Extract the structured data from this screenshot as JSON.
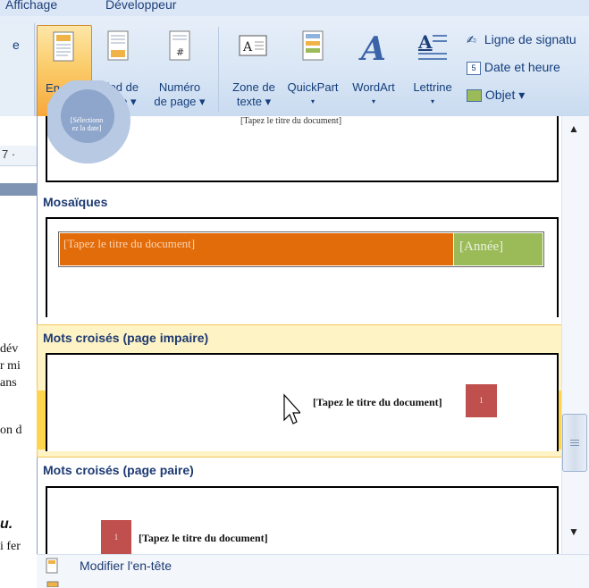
{
  "tabs": [
    "Affichage",
    "Développeur"
  ],
  "ribbon": {
    "header_btn": {
      "line1": "En-tête",
      "arrow": "▾"
    },
    "footer_btn": {
      "line1": "Pied de",
      "line2": "page ▾"
    },
    "pagenum_btn": {
      "line1": "Numéro",
      "line2": "de page ▾"
    },
    "textbox_btn": {
      "line1": "Zone de",
      "line2": "texte ▾"
    },
    "quickpart_btn": {
      "line1": "QuickPart",
      "line2": "▾"
    },
    "wordart_btn": {
      "line1": "WordArt",
      "line2": "▾"
    },
    "dropcap_btn": {
      "line1": "Lettrine",
      "line2": "▾"
    },
    "signature_item": "Ligne de signatu",
    "datetime_item": "Date et heure",
    "object_item": "Objet ▾",
    "left_edge_letter": "e"
  },
  "left_doc": {
    "ruler_text": "7 ·",
    "line1": "dév",
    "line2": "r mi",
    "line3": "ans",
    "line4": "on d",
    "line5": "u.",
    "line6": "i fer"
  },
  "gallery": {
    "top_preview": {
      "circle_text_1": "[Sélectionn",
      "circle_text_2": "ez la date]",
      "title_text": "[Tapez le titre du document]"
    },
    "sections": [
      {
        "title": "Mosaïques",
        "title_text": "[Tapez le titre du document]",
        "year_text": "[Année]"
      },
      {
        "title": "Mots croisés (page impaire)",
        "title_text": "[Tapez le titre du document]",
        "page_num": "1"
      },
      {
        "title": "Mots croisés (page paire)",
        "title_text": "[Tapez le titre du document]",
        "page_num": "1"
      }
    ],
    "footer": {
      "modify_header": "Modifier l'en-tête"
    }
  },
  "colors": {
    "orange": "#e36c0a",
    "green": "#9bbb59",
    "red": "#c0504d"
  }
}
